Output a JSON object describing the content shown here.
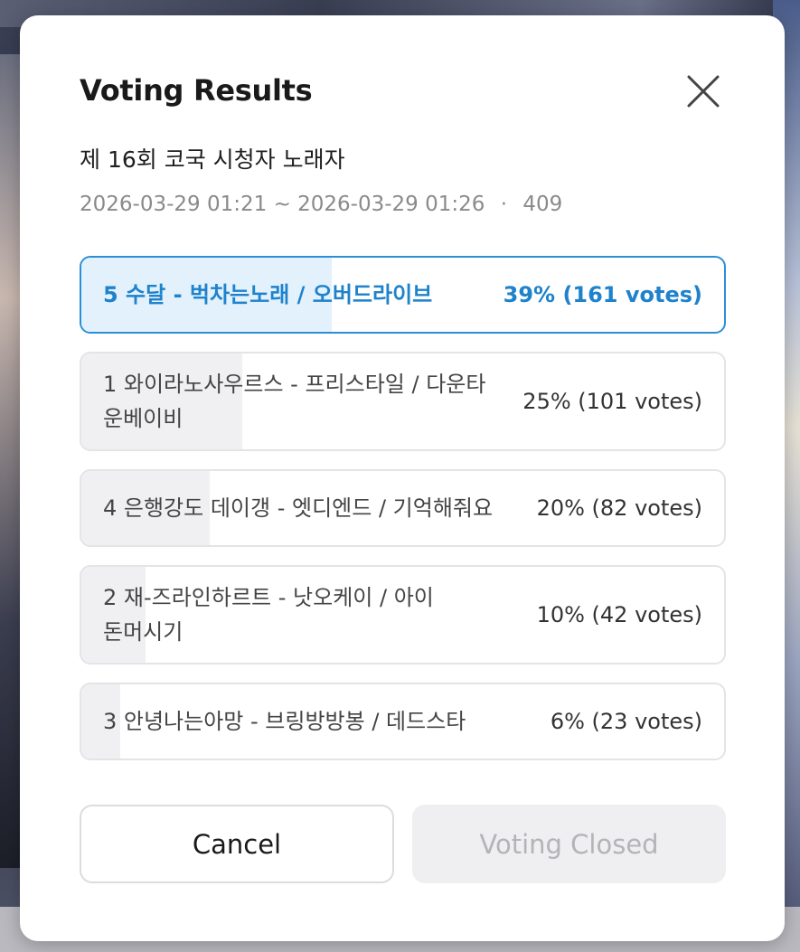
{
  "dialog": {
    "title": "Voting Results",
    "subtitle": "제 16회 코국 시청자 노래자",
    "date_range": "2026-03-29 01:21 ~ 2026-03-29 01:26",
    "separator": "·",
    "total": "409"
  },
  "options": [
    {
      "label": "5 수달 - 벅차는노래 / 오버드라이브",
      "result": "39% (161 votes)",
      "fraction": 0.39,
      "winner": true
    },
    {
      "label": "1 와이라노사우르스 - 프리스타일 / 다운타운베이비",
      "result": "25% (101 votes)",
      "fraction": 0.25,
      "winner": false
    },
    {
      "label": "4 은행강도 데이갱 - 엣디엔드 / 기억해줘요",
      "result": "20% (82 votes)",
      "fraction": 0.2,
      "winner": false
    },
    {
      "label": "2 재-즈라인하르트 - 낫오케이 / 아이돈머시기",
      "result": "10% (42 votes)",
      "fraction": 0.1,
      "winner": false
    },
    {
      "label": "3 안녕나는아망 - 브링방방봉 / 데드스타",
      "result": "6% (23 votes)",
      "fraction": 0.06,
      "winner": false
    }
  ],
  "buttons": {
    "cancel": "Cancel",
    "closed": "Voting Closed"
  },
  "colors": {
    "accent": "#1e82cc",
    "winner_fill": "#e2f1fc",
    "bar_fill": "#f0f0f2"
  },
  "icons": {
    "close": "close-icon"
  }
}
